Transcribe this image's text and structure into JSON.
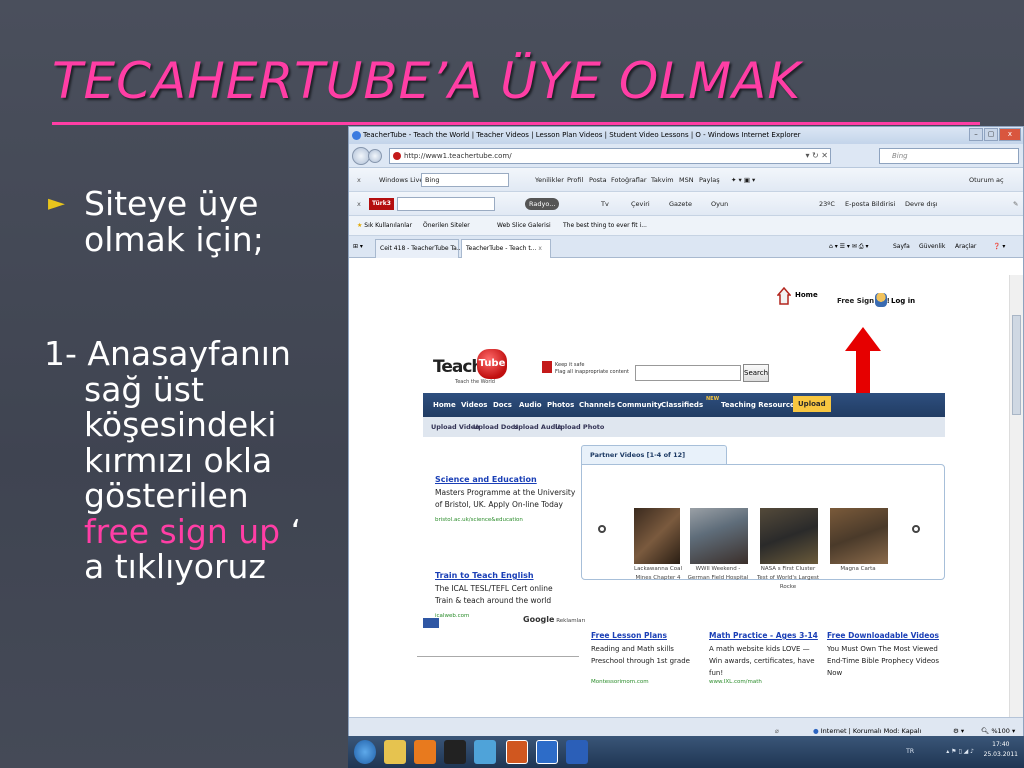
{
  "slide": {
    "title": "TECAHERTUBE’A ÜYE OLMAK",
    "bullet_marker": "►",
    "bullet_lines": [
      "Siteye üye",
      "olmak için;"
    ],
    "para_lines": [
      "1- Anasayfanın",
      "sağ üst",
      "köşesindeki",
      "kırmızı okla",
      "gösterilen"
    ],
    "para_highlight": "free sign up",
    "para_after_highlight": " ‘",
    "para_last": "a tıklıyoruz"
  },
  "browser": {
    "window_title": "TeacherTube - Teach the World | Teacher Videos | Lesson Plan Videos | Student Video Lessons | O - Windows Internet Explorer",
    "url": "http://www1.teachertube.com/",
    "search_placeholder": "Bing",
    "win_controls": [
      "–",
      "▢",
      "x"
    ],
    "toolbar1": {
      "close": "x",
      "windows_live": "Windows Live",
      "search_value": "Bing",
      "links": [
        "Yenilikler",
        "Profil",
        "Posta",
        "Fotoğraflar",
        "Takvim",
        "MSN",
        "Paylaş"
      ],
      "signin": "Oturum aç"
    },
    "toolbar2": {
      "close": "x",
      "brand": "Türk3",
      "radio": "Radyo...",
      "items": [
        "Tv",
        "Çeviri",
        "Gazete",
        "Oyun"
      ],
      "temp": "23ºC",
      "mail": "E-posta Bildirisi",
      "currency": "Devre dışı"
    },
    "favorites": {
      "fav": "Sık Kullanılanlar",
      "suggested": "Önerilen Siteler",
      "gallery": "Web Slice Galerisi",
      "fb": "The best thing to ever fit i..."
    },
    "tabs": [
      {
        "label": "Ceit 418 - TeacherTube Ta..."
      },
      {
        "label": "TeacherTube - Teach t..."
      }
    ],
    "tab_close": "x",
    "command_bar": [
      "Sayfa",
      "Güvenlik",
      "Araçlar"
    ],
    "status": {
      "zone": "Internet | Korumalı Mod: Kapalı",
      "zoom": "%100"
    }
  },
  "teachertube": {
    "home": "Home",
    "signup": "Free Sign up!",
    "login": "Log in",
    "logo_teacher": "Teacher",
    "logo_tube": "Tube",
    "logo_tagline": "Teach the World",
    "flag_line1": "Keep it safe",
    "flag_line2": "Flag all inappropriate content",
    "search_button": "Search",
    "nav": [
      "Home",
      "Videos",
      "Docs",
      "Audio",
      "Photos",
      "Channels",
      "Community",
      "Classifieds",
      "Teaching Resources",
      "Upload"
    ],
    "new_badge": "NEW",
    "subnav": [
      "Upload Video",
      "Upload Docs",
      "Upload Audio",
      "Upload Photo"
    ],
    "ads": [
      {
        "title": "Science and Education",
        "body": [
          "Masters Programme at the University",
          "of Bristol, UK. Apply On-line Today"
        ],
        "url": "bristol.ac.uk/science&education"
      },
      {
        "title": "Train to Teach English",
        "body": [
          "The ICAL TESL/TEFL Cert online",
          "Train & teach around the world"
        ],
        "url": "icalweb.com"
      }
    ],
    "google_label": "Google",
    "google_suffix": "Reklamları",
    "partner_tab": "Partner Videos  [1-4 of 12]",
    "partner_videos": [
      {
        "caption": "Lackawanna Coal Mines Chapter 4"
      },
      {
        "caption": "WWII Weekend - German Field Hospital"
      },
      {
        "caption": "NASA s First Cluster Test of World's Largest Rocke"
      },
      {
        "caption": "Magna Carta"
      }
    ],
    "bottom_ads": [
      {
        "title": "Free Lesson Plans",
        "body": "Reading and Math skills Preschool through 1st grade",
        "url": "Montessorimom.com"
      },
      {
        "title": "Math Practice - Ages 3-14",
        "body": "A math website kids LOVE — Win awards, certificates, have fun!",
        "url": "www.IXL.com/math"
      },
      {
        "title": "Free Downloadable Videos",
        "body": "You Must Own The Most Viewed End-Time Bible Prophecy Videos Now",
        "url": ""
      }
    ]
  },
  "taskbar": {
    "lang": "TR",
    "time": "17:40",
    "date": "25.03.2011"
  },
  "colors": {
    "title_pink": "#ff3ea5",
    "bullet_yellow": "#e8c51c",
    "slide_bg": "#474c59",
    "nav_blue": "#2e4f7f",
    "arrow_red": "#e60000",
    "upload_yellow": "#f7c640"
  }
}
